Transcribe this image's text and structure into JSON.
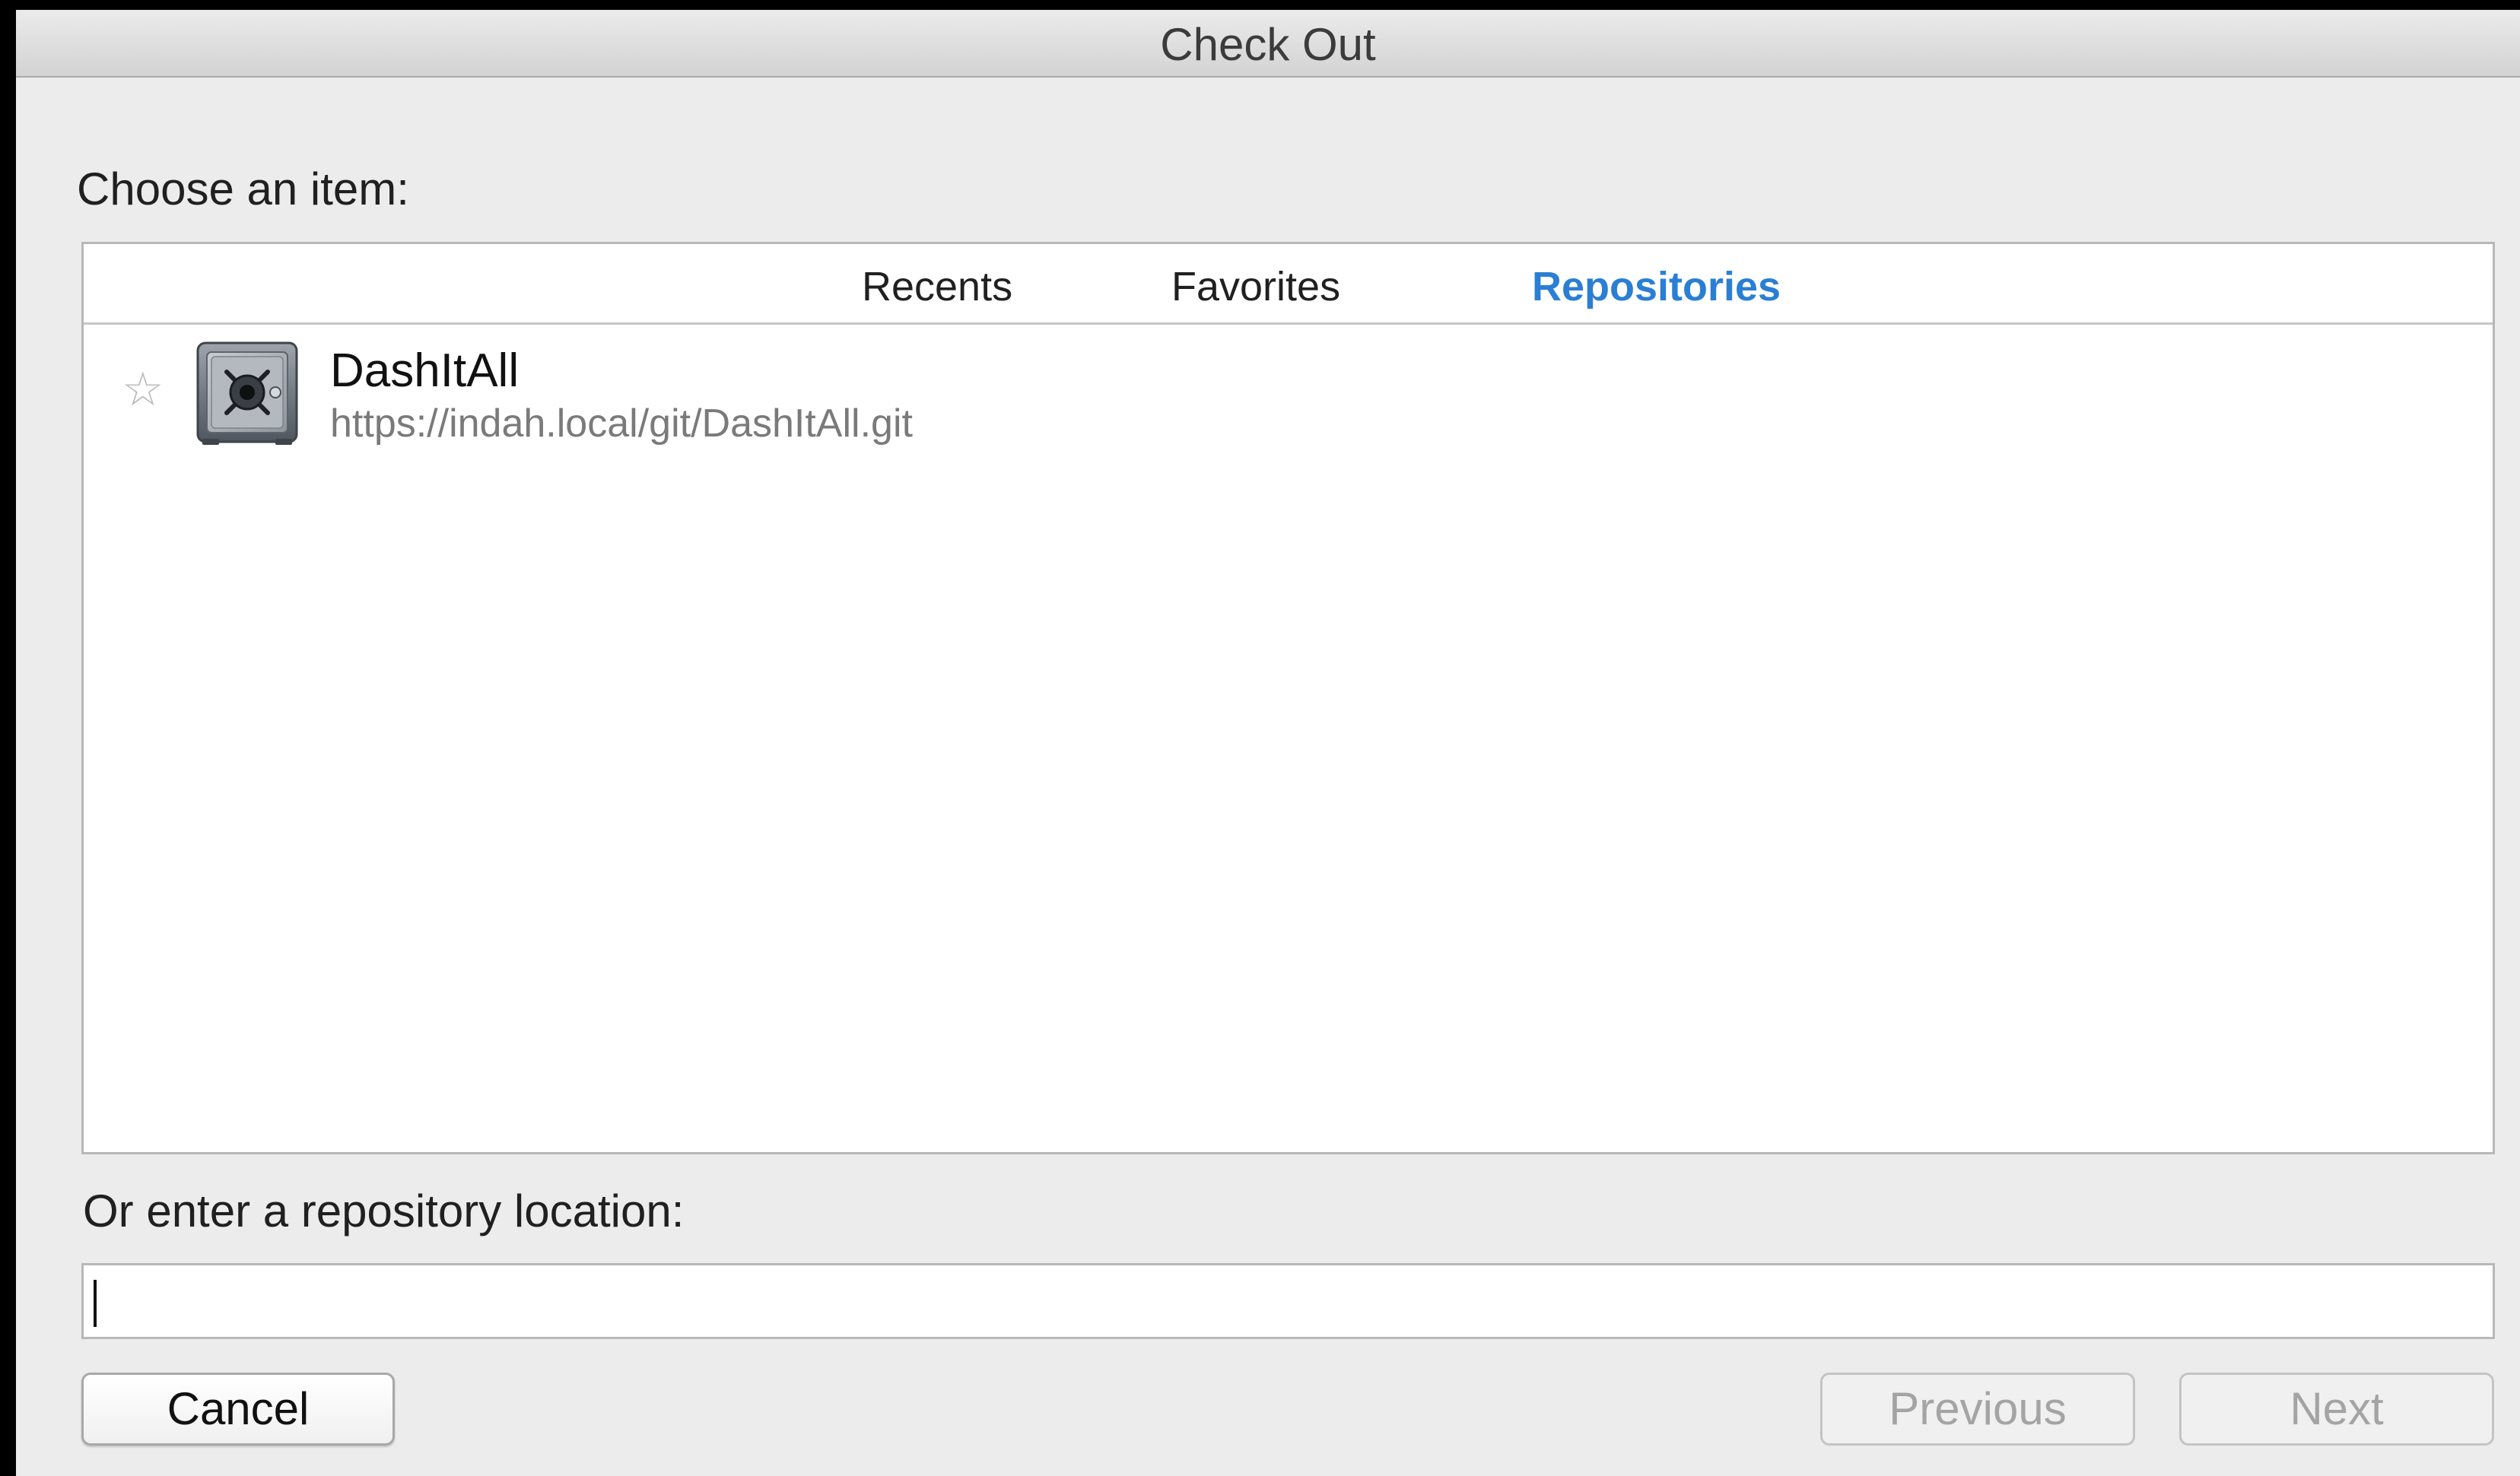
{
  "window": {
    "title": "Check Out"
  },
  "chooser": {
    "label": "Choose an item:",
    "tabs": [
      {
        "label": "Recents",
        "active": false
      },
      {
        "label": "Favorites",
        "active": false
      },
      {
        "label": "Repositories",
        "active": true
      }
    ],
    "items": [
      {
        "name": "DashItAll",
        "url": "https://indah.local/git/DashItAll.git",
        "icon": "safe-vault-icon",
        "favorite_icon": "☆"
      }
    ]
  },
  "location": {
    "label": "Or enter a repository location:",
    "value": "",
    "placeholder": ""
  },
  "buttons": {
    "cancel": "Cancel",
    "previous": "Previous",
    "next": "Next"
  },
  "colors": {
    "active_tab": "#2a7fd4",
    "disabled_text": "#a4a4a4"
  }
}
